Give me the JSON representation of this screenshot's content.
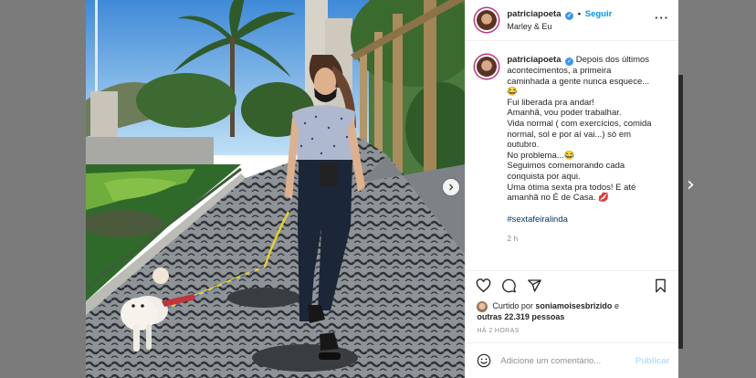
{
  "post": {
    "username": "patriciapoeta",
    "follow_label": "Seguir",
    "location": "Marley & Eu",
    "caption_lines": [
      "Depois dos últimos",
      "acontecimentos, a primeira",
      "caminhada a gente nunca esquece...",
      "😂",
      "Fui liberada pra andar!",
      "Amanhã, vou poder trabalhar.",
      "Vida normal ( com exercícios, comida",
      "normal, sol e por aí vai...) só em",
      "outubro.",
      "No problema...😂",
      "Seguimos comemorando cada",
      "conquista por aqui.",
      "Uma ótima sexta pra todos! E até",
      "amanhã no É de Casa. 💋"
    ],
    "hashtag": "#sextafeiralinda",
    "caption_time": "2 h",
    "likes_prefix": "Curtido por",
    "likes_user": "soniamoisesbrizido",
    "likes_and": "e",
    "likes_others": "outras 22.319 pessoas",
    "posted_ago": "HÁ 2 HORAS",
    "comment_placeholder": "Adicione um comentário...",
    "publish_label": "Publicar"
  },
  "icons": [
    "verified-badge-icon",
    "more-options-icon",
    "heart-icon",
    "comment-icon",
    "share-icon",
    "bookmark-icon",
    "emoji-icon",
    "chevron-right-icon"
  ],
  "colors": {
    "accent": "#0095f6",
    "verified": "#3897f0",
    "overlay": "#7b7b7b",
    "publish_disabled": "#b2dffc"
  }
}
